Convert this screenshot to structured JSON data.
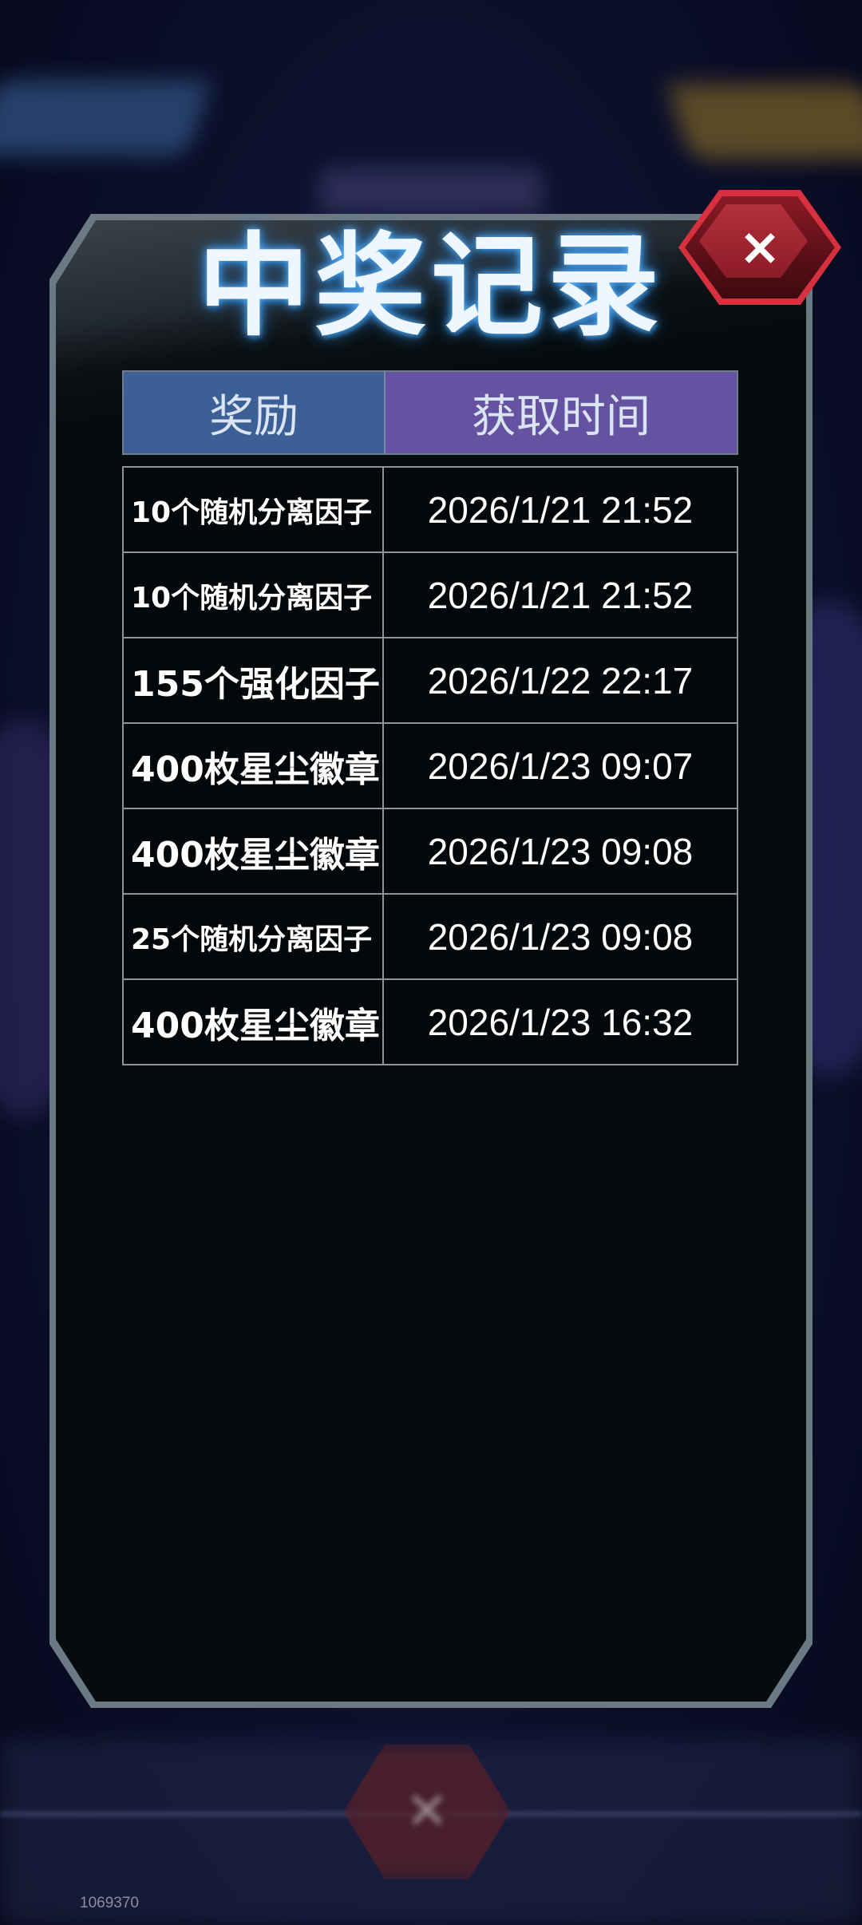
{
  "dialog": {
    "title": "中奖记录",
    "close_label": "×"
  },
  "table": {
    "headers": {
      "reward": "奖励",
      "time": "获取时间"
    },
    "rows": [
      {
        "reward": "10个随机分离因子",
        "time": "2026/1/21 21:52"
      },
      {
        "reward": "10个随机分离因子",
        "time": "2026/1/21 21:52"
      },
      {
        "reward": "155个强化因子",
        "time": "2026/1/22 22:17"
      },
      {
        "reward": "400枚星尘徽章",
        "time": "2026/1/23 09:07"
      },
      {
        "reward": "400枚星尘徽章",
        "time": "2026/1/23 09:08"
      },
      {
        "reward": "25个随机分离因子",
        "time": "2026/1/23 09:08"
      },
      {
        "reward": "400枚星尘徽章",
        "time": "2026/1/23 16:32"
      }
    ]
  },
  "footer": {
    "id_text": "1069370"
  },
  "colors": {
    "header_reward_bg": "#3c5f96",
    "header_time_bg": "#6552a0",
    "close_button": "#d7303f",
    "title_glow": "#5fb8ff"
  }
}
